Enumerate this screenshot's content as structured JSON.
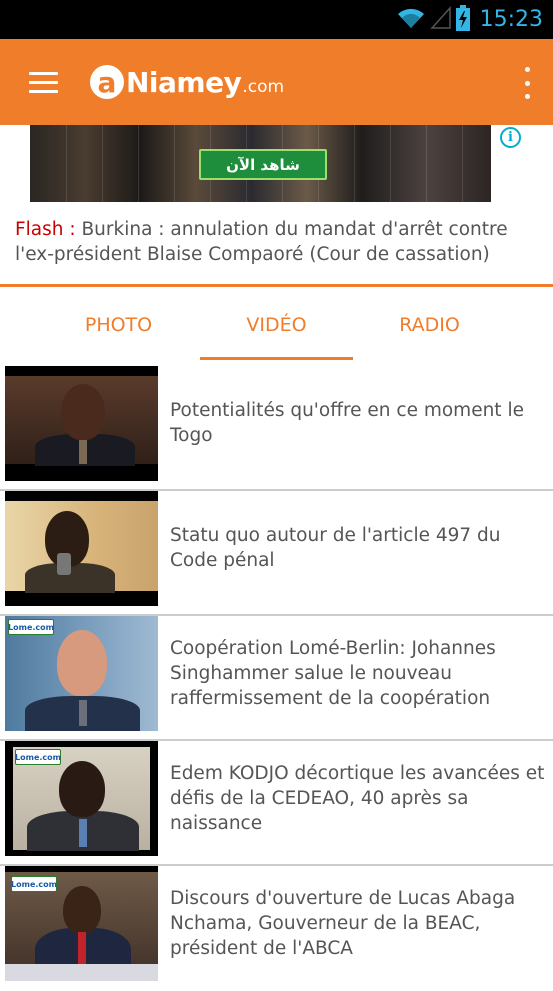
{
  "status_bar": {
    "time": "15:23",
    "icons": [
      "wifi-icon",
      "signal-icon",
      "battery-charging-icon"
    ]
  },
  "app_bar": {
    "logo_mark": "a",
    "logo_name": "Niamey",
    "logo_tld": ".com",
    "menu_icon": "hamburger-menu-icon",
    "overflow_icon": "overflow-menu-icon",
    "brand_color": "#f07d2a"
  },
  "ad": {
    "cta_label": "شاهد الآن",
    "info_icon": "ad-info-icon"
  },
  "flash": {
    "label": "Flash :",
    "text": " Burkina : annulation du mandat d'arrêt contre l'ex-président Blaise Compaoré (Cour de cassation)"
  },
  "tabs": [
    {
      "label": "PHOTO",
      "selected": false
    },
    {
      "label": "VIDÉO",
      "selected": true
    },
    {
      "label": "RADIO",
      "selected": false
    }
  ],
  "videos": [
    {
      "title": "Potentialités qu'offre en ce moment le Togo",
      "thumb_badge": ""
    },
    {
      "title": "Statu quo autour de l'article 497 du Code pénal",
      "thumb_badge": ""
    },
    {
      "title": "Coopération Lomé-Berlin: Johannes Singhammer salue le nouveau raffermissement de la coopération",
      "thumb_badge": "Lome.com"
    },
    {
      "title": "Edem KODJO décortique les avancées et défis de la CEDEAO, 40 après sa naissance",
      "thumb_badge": "Lome.com"
    },
    {
      "title": "Discours d'ouverture de Lucas Abaga Nchama, Gouverneur de la BEAC, président de l'ABCA",
      "thumb_badge": "Lome.com"
    }
  ]
}
